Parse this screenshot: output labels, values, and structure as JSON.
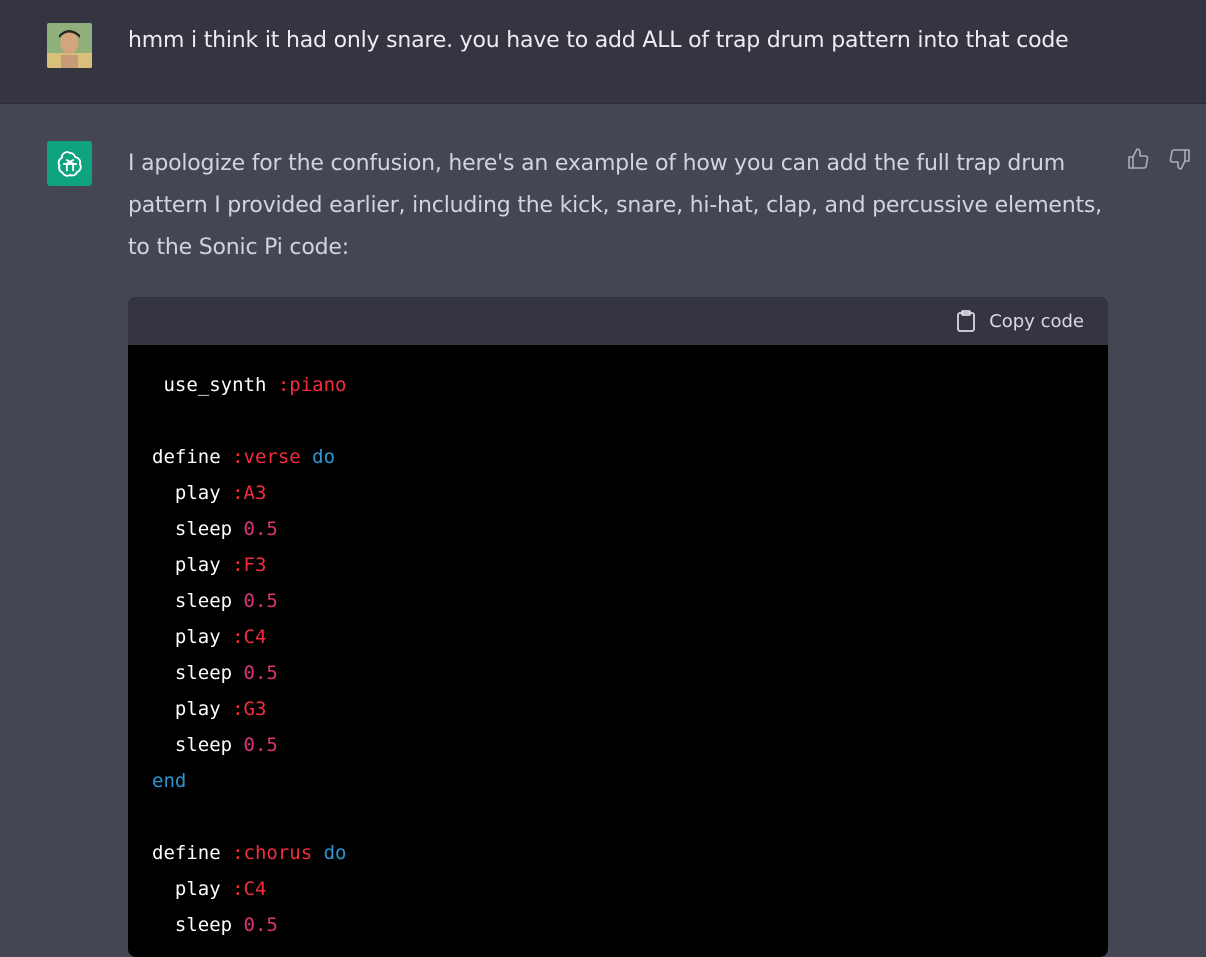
{
  "user_message": {
    "text": "hmm i think it had only snare. you have to add ALL of trap drum pattern into that code"
  },
  "assistant_message": {
    "text": "I apologize for the confusion, here's an example of how you can add the full trap drum pattern I provided earlier, including the kick, snare, hi-hat, clap, and percussive elements, to the Sonic Pi code:",
    "code_block": {
      "copy_label": "Copy code",
      "lines": [
        {
          "indent": " ",
          "plain": "use_synth ",
          "sym": ":piano",
          "num": "",
          "kw": ""
        },
        {
          "indent": "",
          "plain": "",
          "sym": "",
          "num": "",
          "kw": ""
        },
        {
          "indent": "",
          "plain": "define ",
          "sym": ":verse",
          "num": "",
          "kw": " do"
        },
        {
          "indent": "  ",
          "plain": "play ",
          "sym": ":A3",
          "num": "",
          "kw": ""
        },
        {
          "indent": "  ",
          "plain": "sleep ",
          "sym": "",
          "num": "0.5",
          "kw": ""
        },
        {
          "indent": "  ",
          "plain": "play ",
          "sym": ":F3",
          "num": "",
          "kw": ""
        },
        {
          "indent": "  ",
          "plain": "sleep ",
          "sym": "",
          "num": "0.5",
          "kw": ""
        },
        {
          "indent": "  ",
          "plain": "play ",
          "sym": ":C4",
          "num": "",
          "kw": ""
        },
        {
          "indent": "  ",
          "plain": "sleep ",
          "sym": "",
          "num": "0.5",
          "kw": ""
        },
        {
          "indent": "  ",
          "plain": "play ",
          "sym": ":G3",
          "num": "",
          "kw": ""
        },
        {
          "indent": "  ",
          "plain": "sleep ",
          "sym": "",
          "num": "0.5",
          "kw": ""
        },
        {
          "indent": "",
          "plain": "",
          "sym": "",
          "num": "",
          "kw": "end"
        },
        {
          "indent": "",
          "plain": "",
          "sym": "",
          "num": "",
          "kw": ""
        },
        {
          "indent": "",
          "plain": "define ",
          "sym": ":chorus",
          "num": "",
          "kw": " do"
        },
        {
          "indent": "  ",
          "plain": "play ",
          "sym": ":C4",
          "num": "",
          "kw": ""
        },
        {
          "indent": "  ",
          "plain": "sleep ",
          "sym": "",
          "num": "0.5",
          "kw": ""
        }
      ]
    }
  },
  "colors": {
    "user_bg": "#343541",
    "assistant_bg": "#444654",
    "gpt_avatar": "#10a37f",
    "code_keyword": "#2e95d3",
    "code_symbol": "#f22c3d",
    "code_number": "#df3079"
  },
  "icons": {
    "gpt_avatar": "openai-logo-icon",
    "copy": "clipboard-icon",
    "thumbs_up": "thumbs-up-icon",
    "thumbs_down": "thumbs-down-icon"
  }
}
